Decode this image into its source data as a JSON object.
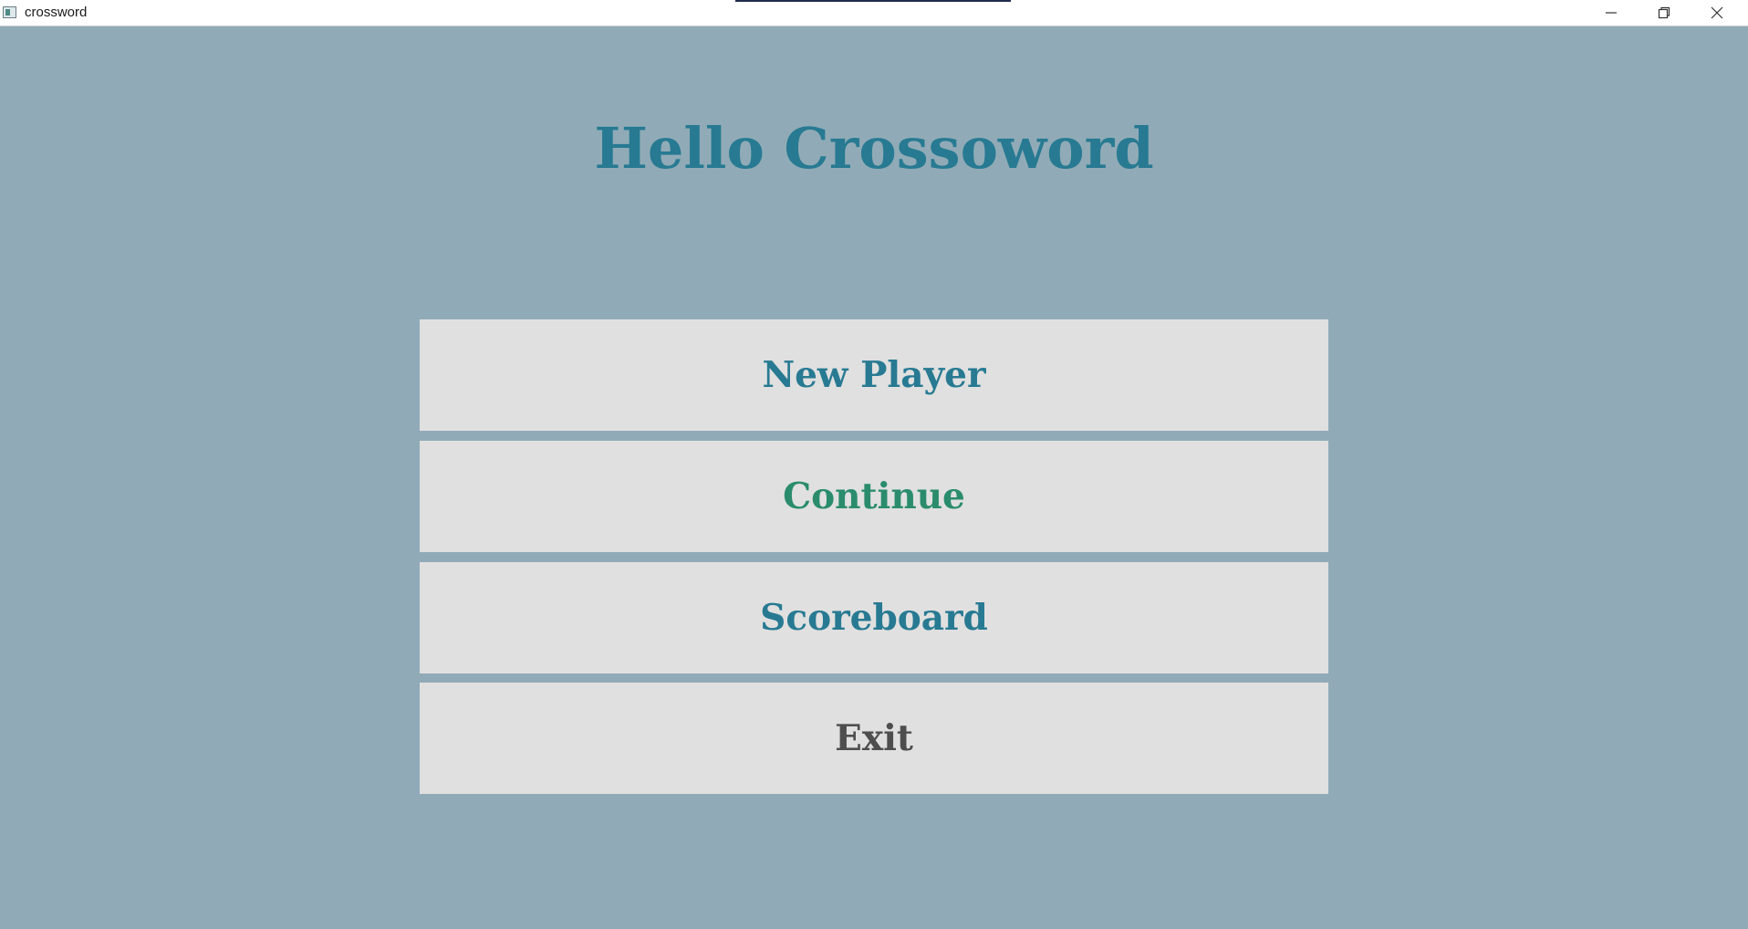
{
  "window": {
    "title": "crossword",
    "controls": {
      "minimize_icon": "minimize-icon",
      "maximize_icon": "restore-icon",
      "close_icon": "close-icon"
    }
  },
  "main": {
    "heading": "Hello Crossoword",
    "buttons": {
      "new_player": "New Player",
      "continue": "Continue",
      "scoreboard": "Scoreboard",
      "exit": "Exit"
    }
  },
  "colors": {
    "background": "#90abb7",
    "button_bg": "#e0e0e0",
    "heading": "#277a92",
    "continue_text": "#2a8c6c",
    "exit_text": "#4e4e4e"
  }
}
